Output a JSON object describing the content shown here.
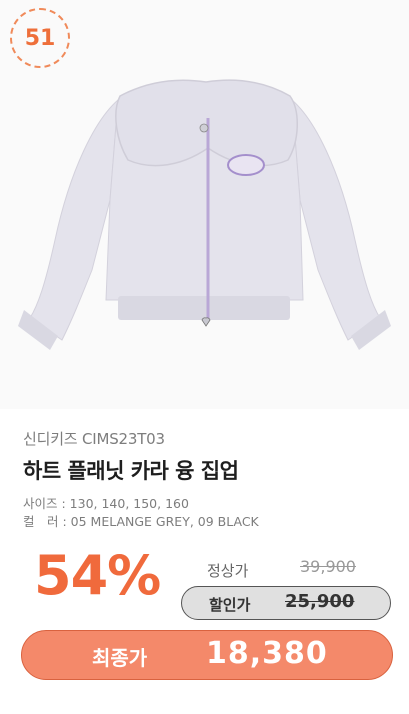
{
  "product": {
    "rank_badge": "51",
    "image_alt": "하트 플래닛 카라 융 집업 product photo",
    "brand_code": "신디키즈 CIMS23T03",
    "name": "하트 플래닛 카라 융 집업",
    "sizes_line": "사이즈 : 130, 140, 150, 160",
    "colors_line": "컬　러 : 05 MELANGE GREY, 09 BLACK"
  },
  "pricing": {
    "discount_rate": "54%",
    "regular_label": "정상가",
    "regular_price": "39,900",
    "sale_label": "할인가",
    "sale_price": "25,900",
    "final_label": "최종가",
    "final_price": "18,380"
  },
  "colors": {
    "accent": "#f06a3c",
    "final_pill_bg": "#f4896a",
    "sale_pill_bg": "#e0e0e0",
    "jacket_grey": "#e4e3ec",
    "zipper_lilac": "#b9a7d6"
  }
}
